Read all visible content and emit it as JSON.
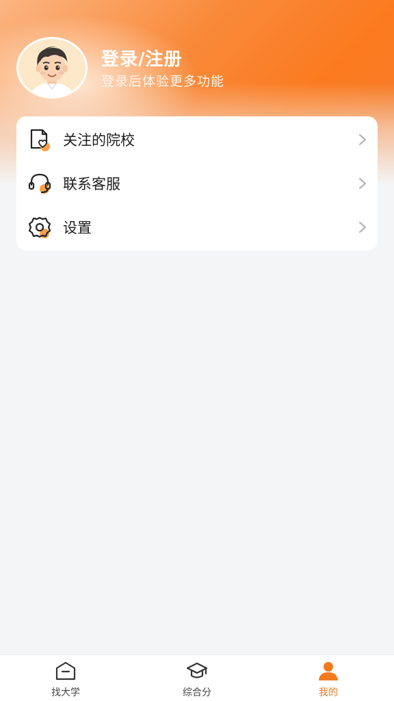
{
  "profile": {
    "title": "登录/注册",
    "subtitle": "登录后体验更多功能",
    "avatar_icon": "avatar-boy-icon"
  },
  "menu": {
    "items": [
      {
        "label": "关注的院校",
        "icon": "favorite-school-icon"
      },
      {
        "label": "联系客服",
        "icon": "headset-icon"
      },
      {
        "label": "设置",
        "icon": "gear-icon"
      }
    ]
  },
  "tabbar": {
    "tabs": [
      {
        "label": "找大学",
        "icon": "school-building-icon",
        "active": false
      },
      {
        "label": "综合分",
        "icon": "graduation-cap-icon",
        "active": false
      },
      {
        "label": "我的",
        "icon": "person-icon",
        "active": true
      }
    ]
  },
  "colors": {
    "accent": "#f47a1f",
    "header_orange": "#fb7a1f",
    "background": "#f4f5f7",
    "text_primary": "#1f1f1f",
    "icon_badge": "#f5a04a"
  }
}
